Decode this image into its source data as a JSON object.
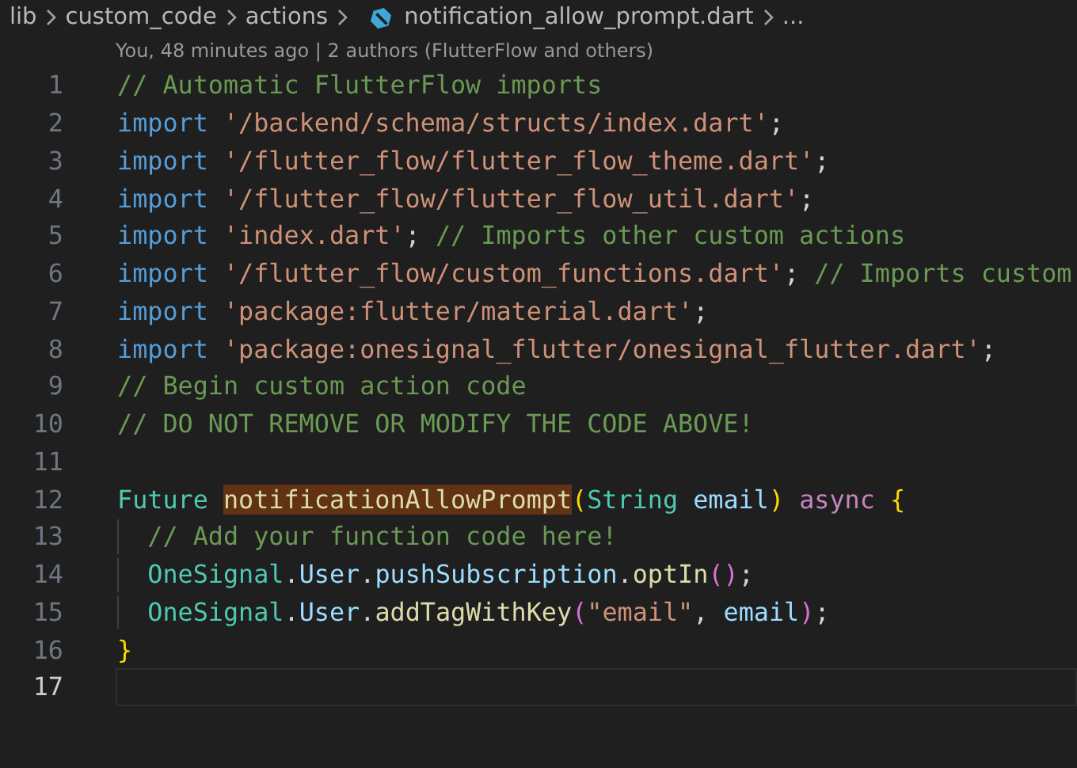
{
  "breadcrumb": [
    {
      "label": "lib",
      "kind": "folder"
    },
    {
      "label": "custom_code",
      "kind": "folder"
    },
    {
      "label": "actions",
      "kind": "folder"
    },
    {
      "label": "notification_allow_prompt.dart",
      "kind": "file"
    },
    {
      "label": "...",
      "kind": "more"
    }
  ],
  "codelens": "You, 48 minutes ago | 2 authors (FlutterFlow and others)",
  "lines": [
    {
      "number": "1",
      "current": false,
      "tokens": [
        {
          "text": "// Automatic FlutterFlow imports",
          "kind": "comment"
        }
      ]
    },
    {
      "number": "2",
      "current": false,
      "tokens": [
        {
          "text": "import ",
          "kind": "keyword"
        },
        {
          "text": "'/backend/schema/structs/index.dart'",
          "kind": "string"
        },
        {
          "text": ";",
          "kind": "punct"
        }
      ]
    },
    {
      "number": "3",
      "current": false,
      "tokens": [
        {
          "text": "import ",
          "kind": "keyword"
        },
        {
          "text": "'/flutter_flow/flutter_flow_theme.dart'",
          "kind": "string"
        },
        {
          "text": ";",
          "kind": "punct"
        }
      ]
    },
    {
      "number": "4",
      "current": false,
      "tokens": [
        {
          "text": "import ",
          "kind": "keyword"
        },
        {
          "text": "'/flutter_flow/flutter_flow_util.dart'",
          "kind": "string"
        },
        {
          "text": ";",
          "kind": "punct"
        }
      ]
    },
    {
      "number": "5",
      "current": false,
      "tokens": [
        {
          "text": "import ",
          "kind": "keyword"
        },
        {
          "text": "'index.dart'",
          "kind": "string"
        },
        {
          "text": "; ",
          "kind": "punct"
        },
        {
          "text": "// Imports other custom actions",
          "kind": "comment"
        }
      ]
    },
    {
      "number": "6",
      "current": false,
      "tokens": [
        {
          "text": "import ",
          "kind": "keyword"
        },
        {
          "text": "'/flutter_flow/custom_functions.dart'",
          "kind": "string"
        },
        {
          "text": "; ",
          "kind": "punct"
        },
        {
          "text": "// Imports custom",
          "kind": "comment"
        }
      ]
    },
    {
      "number": "7",
      "current": false,
      "tokens": [
        {
          "text": "import ",
          "kind": "keyword"
        },
        {
          "text": "'package:flutter/material.dart'",
          "kind": "string"
        },
        {
          "text": ";",
          "kind": "punct"
        }
      ]
    },
    {
      "number": "8",
      "current": false,
      "tokens": [
        {
          "text": "import ",
          "kind": "keyword"
        },
        {
          "text": "'package:onesignal_flutter/onesignal_flutter.dart'",
          "kind": "string"
        },
        {
          "text": ";",
          "kind": "punct"
        }
      ]
    },
    {
      "number": "9",
      "current": false,
      "tokens": [
        {
          "text": "// Begin custom action code",
          "kind": "comment"
        }
      ]
    },
    {
      "number": "10",
      "current": false,
      "tokens": [
        {
          "text": "// DO NOT REMOVE OR MODIFY THE CODE ABOVE!",
          "kind": "comment"
        }
      ]
    },
    {
      "number": "11",
      "current": false
    },
    {
      "number": "12",
      "current": false,
      "tokens": [
        {
          "text": "Future ",
          "kind": "type"
        },
        {
          "text": "notificationAllowPrompt",
          "kind": "highlight"
        },
        {
          "text": "(",
          "kind": "bracket"
        },
        {
          "text": "String ",
          "kind": "type"
        },
        {
          "text": "email",
          "kind": "variable"
        },
        {
          "text": ")",
          "kind": "bracket"
        },
        {
          "text": " async ",
          "kind": "control"
        },
        {
          "text": "{",
          "kind": "bracket"
        }
      ]
    },
    {
      "number": "13",
      "current": false,
      "tokens": [
        {
          "text": "  // Add your function code here!",
          "kind": "comment"
        }
      ]
    },
    {
      "number": "14",
      "current": false,
      "tokens": [
        {
          "text": "  OneSignal",
          "kind": "type"
        },
        {
          "text": ".",
          "kind": "punct"
        },
        {
          "text": "User",
          "kind": "variable"
        },
        {
          "text": ".",
          "kind": "punct"
        },
        {
          "text": "pushSubscription",
          "kind": "variable"
        },
        {
          "text": ".",
          "kind": "punct"
        },
        {
          "text": "optIn",
          "kind": "function"
        },
        {
          "text": "()",
          "kind": "bracket2"
        },
        {
          "text": ";",
          "kind": "punct"
        }
      ]
    },
    {
      "number": "15",
      "current": false,
      "tokens": [
        {
          "text": "  OneSignal",
          "kind": "type"
        },
        {
          "text": ".",
          "kind": "punct"
        },
        {
          "text": "User",
          "kind": "variable"
        },
        {
          "text": ".",
          "kind": "punct"
        },
        {
          "text": "addTagWithKey",
          "kind": "function"
        },
        {
          "text": "(",
          "kind": "bracket2"
        },
        {
          "text": "\"email\"",
          "kind": "string"
        },
        {
          "text": ", ",
          "kind": "punct"
        },
        {
          "text": "email",
          "kind": "variable"
        },
        {
          "text": ")",
          "kind": "bracket2"
        },
        {
          "text": ";",
          "kind": "punct"
        }
      ]
    },
    {
      "number": "16",
      "current": false,
      "tokens": [
        {
          "text": "}",
          "kind": "bracket"
        }
      ]
    },
    {
      "number": "17",
      "current": true
    }
  ]
}
